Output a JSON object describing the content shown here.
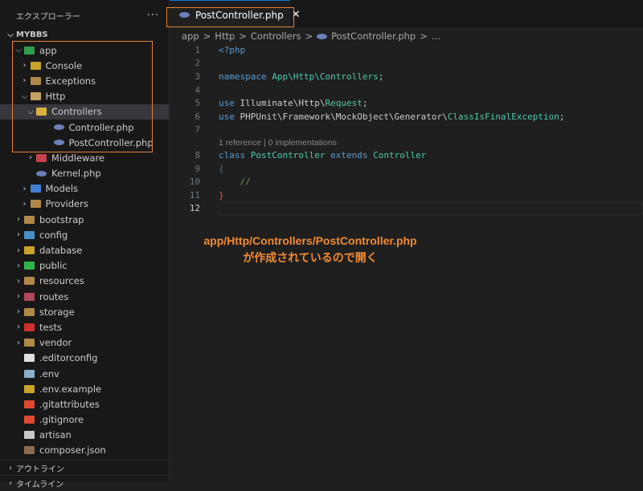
{
  "sidebar": {
    "title": "エクスプローラー",
    "more_icon": "ellipsis-icon",
    "project": "MYBBS",
    "tree": [
      {
        "label": "app",
        "depth": 0,
        "type": "folder",
        "open": true,
        "color": "#2e9e4f"
      },
      {
        "label": "Console",
        "depth": 1,
        "type": "folder",
        "open": false,
        "color": "#c9a227"
      },
      {
        "label": "Exceptions",
        "depth": 1,
        "type": "folder",
        "open": false,
        "color": "#b08848"
      },
      {
        "label": "Http",
        "depth": 1,
        "type": "folder",
        "open": true,
        "color": "#c8a060"
      },
      {
        "label": "Controllers",
        "depth": 2,
        "type": "folder",
        "open": true,
        "color": "#d8b040",
        "selected": true
      },
      {
        "label": "Controller.php",
        "depth": 3,
        "type": "php",
        "color": "#6b7fb8"
      },
      {
        "label": "PostController.php",
        "depth": 3,
        "type": "php",
        "color": "#6b7fb8"
      },
      {
        "label": "Middleware",
        "depth": 2,
        "type": "folder",
        "open": false,
        "color": "#c8424d"
      },
      {
        "label": "Kernel.php",
        "depth": 2,
        "type": "php",
        "noChevron": true,
        "color": "#6b7fb8"
      },
      {
        "label": "Models",
        "depth": 1,
        "type": "folder",
        "open": false,
        "color": "#3f7fd0"
      },
      {
        "label": "Providers",
        "depth": 1,
        "type": "folder",
        "open": false,
        "color": "#b08848"
      },
      {
        "label": "bootstrap",
        "depth": 0,
        "type": "folder",
        "open": false,
        "color": "#b08848"
      },
      {
        "label": "config",
        "depth": 0,
        "type": "folder",
        "open": false,
        "color": "#4a90c8"
      },
      {
        "label": "database",
        "depth": 0,
        "type": "folder",
        "open": false,
        "color": "#c9a227"
      },
      {
        "label": "public",
        "depth": 0,
        "type": "folder",
        "open": false,
        "color": "#2fb54a"
      },
      {
        "label": "resources",
        "depth": 0,
        "type": "folder",
        "open": false,
        "color": "#b08848"
      },
      {
        "label": "routes",
        "depth": 0,
        "type": "folder",
        "open": false,
        "color": "#b0465a"
      },
      {
        "label": "storage",
        "depth": 0,
        "type": "folder",
        "open": false,
        "color": "#b08848"
      },
      {
        "label": "tests",
        "depth": 0,
        "type": "folder",
        "open": false,
        "color": "#d03030"
      },
      {
        "label": "vendor",
        "depth": 0,
        "type": "folder",
        "open": false,
        "color": "#b08848"
      },
      {
        "label": ".editorconfig",
        "depth": 0,
        "type": "file",
        "noChevron": true,
        "color": "#e0e0e0"
      },
      {
        "label": ".env",
        "depth": 0,
        "type": "file",
        "noChevron": true,
        "color": "#8ab0c8"
      },
      {
        "label": ".env.example",
        "depth": 0,
        "type": "file",
        "noChevron": true,
        "color": "#c9a227"
      },
      {
        "label": ".gitattributes",
        "depth": 0,
        "type": "file",
        "noChevron": true,
        "color": "#e04a32"
      },
      {
        "label": ".gitignore",
        "depth": 0,
        "type": "file",
        "noChevron": true,
        "color": "#e04a32"
      },
      {
        "label": "artisan",
        "depth": 0,
        "type": "file",
        "noChevron": true,
        "color": "#c8c8c8"
      },
      {
        "label": "composer.json",
        "depth": 0,
        "type": "file",
        "noChevron": true,
        "color": "#8a6a50"
      }
    ],
    "outline": "アウトライン",
    "timeline": "タイムライン"
  },
  "tab": {
    "label": "PostController.php",
    "close_icon": "close-icon"
  },
  "breadcrumb": [
    "app",
    ">",
    "Http",
    ">",
    "Controllers",
    ">",
    "PostController.php",
    ">",
    "..."
  ],
  "code": [
    {
      "n": "1",
      "tokens": [
        [
          "<?php",
          "k"
        ]
      ]
    },
    {
      "n": "2",
      "tokens": []
    },
    {
      "n": "3",
      "tokens": [
        [
          "namespace ",
          "k"
        ],
        [
          "App\\Http\\Controllers",
          "t"
        ],
        [
          ";",
          "p"
        ]
      ]
    },
    {
      "n": "4",
      "tokens": []
    },
    {
      "n": "5",
      "tokens": [
        [
          "use ",
          "k"
        ],
        [
          "Illuminate\\Http\\",
          "p"
        ],
        [
          "Request",
          "t"
        ],
        [
          ";",
          "p"
        ]
      ]
    },
    {
      "n": "6",
      "tokens": [
        [
          "use ",
          "k"
        ],
        [
          "PHPUnit\\Framework\\MockObject\\Generator\\",
          "p"
        ],
        [
          "ClassIsFinalException",
          "t"
        ],
        [
          ";",
          "p"
        ]
      ]
    },
    {
      "n": "7",
      "tokens": []
    },
    {
      "n": "",
      "lens": "1 reference | 0 implementations"
    },
    {
      "n": "8",
      "tokens": [
        [
          "class ",
          "k"
        ],
        [
          "PostController ",
          "t"
        ],
        [
          "extends ",
          "k"
        ],
        [
          "Controller",
          "t"
        ]
      ]
    },
    {
      "n": "9",
      "tokens": [
        [
          "{",
          "b"
        ]
      ]
    },
    {
      "n": "10",
      "tokens": [
        [
          "    //",
          "c"
        ]
      ]
    },
    {
      "n": "11",
      "tokens": [
        [
          "}",
          "r"
        ]
      ]
    },
    {
      "n": "12",
      "tokens": [],
      "current": true
    }
  ],
  "annotation": {
    "line1": "app/Http/Controllers/PostController.php",
    "line2": "が作成されているので開く",
    "color": "#f28b33"
  }
}
